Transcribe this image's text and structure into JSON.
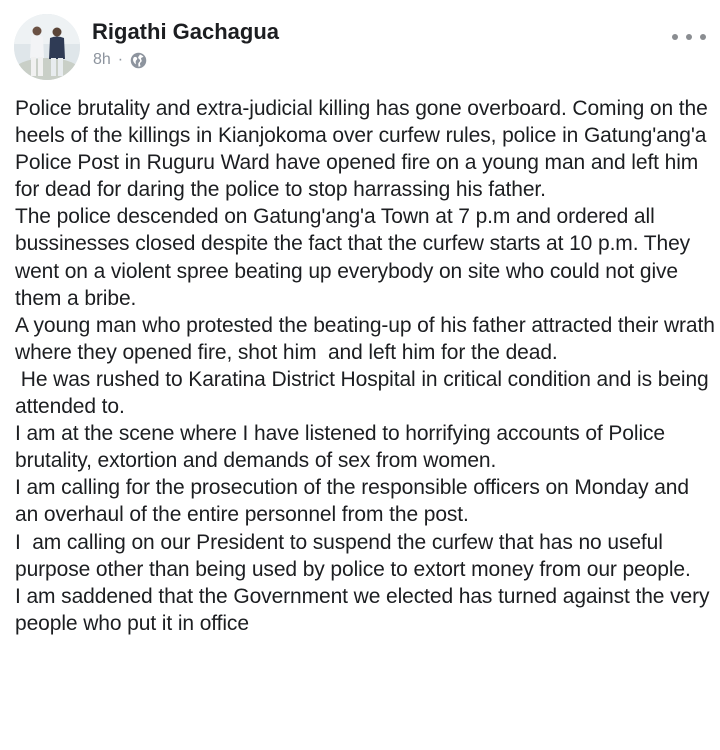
{
  "post": {
    "author": "Rigathi Gachagua",
    "time": "8h",
    "meta_separator": "·",
    "privacy_icon": "globe-icon",
    "more_icon": "more-options-icon",
    "paragraphs": [
      "Police brutality and extra-judicial killing has gone overboard. Coming on the heels of the killings in Kianjokoma over curfew rules, police in Gatung'ang'a Police Post in Ruguru Ward have opened fire on a young man and left him for dead for daring the police to stop harrassing his father.",
      "The police descended on Gatung'ang'a Town at 7 p.m and ordered all bussinesses closed despite the fact that the curfew starts at 10 p.m. They went on a violent spree beating up everybody on site who could not give them a bribe.",
      "A young man who protested the beating-up of his father attracted their wrath where they opened fire, shot him  and left him for the dead.",
      " He was rushed to Karatina District Hospital in critical condition and is being attended to.",
      "I am at the scene where I have listened to horrifying accounts of Police brutality, extortion and demands of sex from women.",
      "I am calling for the prosecution of the responsible officers on Monday and an overhaul of the entire personnel from the post.",
      "I  am calling on our President to suspend the curfew that has no useful purpose other than being used by police to extort money from our people.",
      "I am saddened that the Government we elected has turned against the very people who put it in office"
    ]
  },
  "colors": {
    "text": "#1c1e21",
    "meta": "#8d949e",
    "icon": "#8a8d91",
    "background": "#ffffff"
  }
}
